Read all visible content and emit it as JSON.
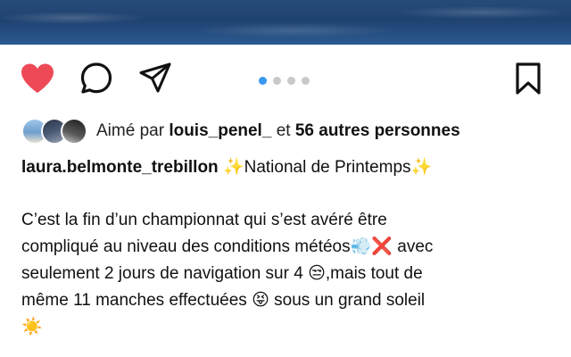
{
  "post": {
    "carousel": {
      "total": 4,
      "active_index": 0
    },
    "likes": {
      "prefix": "Aimé par",
      "user": "louis_penel_",
      "conj": "et",
      "others": "56 autres personnes"
    },
    "caption": {
      "username": "laura.belmonte_trebillon",
      "sparkle_left": "✨",
      "title": "National de Printemps",
      "sparkle_right": "✨"
    },
    "body": {
      "line1": "C’est la fin d’un championnat qui s’est avéré être",
      "line2a": "compliqué au niveau des conditions météos",
      "emoji_wind": "💨",
      "emoji_cross": "❌",
      "line2b": "avec",
      "line3a": "seulement 2 jours de navigation sur 4",
      "emoji_unamused": "😒",
      "line3b": ",mais tout de",
      "line4a": "même 11 manches effectuées",
      "emoji_tongue": "😝",
      "line4b": "sous un grand soleil",
      "emoji_sun": "☀️"
    }
  },
  "icons": {
    "like": "heart-icon",
    "comment": "comment-icon",
    "share": "paper-plane-icon",
    "save": "bookmark-icon"
  },
  "colors": {
    "heart": "#ed4956",
    "dot_active": "#3897f0",
    "dot_inactive": "#c9c9c9",
    "photo": "#274b79"
  }
}
